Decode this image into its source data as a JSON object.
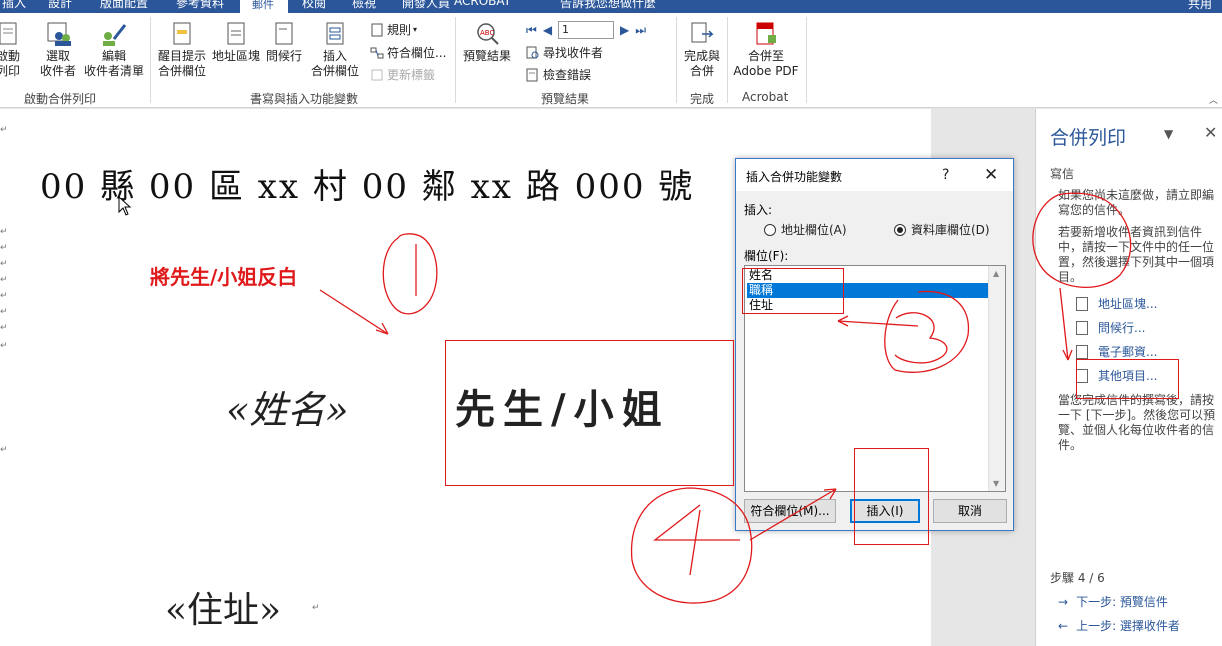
{
  "ribbon": {
    "tabs": {
      "t1": "插入",
      "t2": "設計",
      "t3": "版面配置",
      "t4": "參考資料",
      "t5": "郵件",
      "t6": "校閱",
      "t7": "檢視",
      "t8": "開發人員",
      "t9": "ACROBAT",
      "t10": "告訴我您想做什麼",
      "t11": "共用"
    },
    "start_group": {
      "start_label": "啟動\n列印",
      "select_label": "選取\n收件者",
      "edit_label": "編輯\n收件者清單",
      "group_label": "啟動合併列印"
    },
    "write_group": {
      "highlight_label": "醒目提示\n合併欄位",
      "address_label": "地址區塊",
      "greeting_label": "問候行",
      "insert_field_label": "插入\n合併欄位",
      "rules_label": "規則",
      "match_label": "符合欄位...",
      "update_label": "更新標籤",
      "group_label": "書寫與插入功能變數"
    },
    "preview_group": {
      "preview_label": "預覽結果",
      "record_value": "1",
      "find_label": "尋找收件者",
      "check_label": "檢查錯誤",
      "group_label": "預覽結果"
    },
    "finish_group": {
      "finish_label": "完成與\n合併",
      "group_label": "完成"
    },
    "acrobat_group": {
      "merge_pdf_label": "合併至\nAdobe PDF",
      "group_label": "Acrobat"
    }
  },
  "document": {
    "address_line": "00 縣 00 區 xx 村 00 鄰 xx 路 000 號",
    "annotation": "將先生/小姐反白",
    "field_name": "«姓名»",
    "title_text": "先生/小姐",
    "field_address": "«住址»",
    "para_mark": "↵"
  },
  "dialog": {
    "title": "插入合併功能變數",
    "help": "?",
    "close": "✕",
    "insert_label": "插入:",
    "radio_address": "地址欄位(A)",
    "radio_database": "資料庫欄位(D)",
    "fields_label": "欄位(F):",
    "fields": [
      "姓名",
      "職稱",
      "住址"
    ],
    "match_button": "符合欄位(M)...",
    "insert_button": "插入(I)",
    "cancel_button": "取消"
  },
  "pane": {
    "title": "合併列印",
    "section": "寫信",
    "text1": "如果您尚未這麼做，請立即編寫您的信件。",
    "text2": "若要新增收件者資訊到信件中，請按一下文件中的任一位置，然後選擇下列其中一個項目。",
    "link_address": "地址區塊...",
    "link_greeting": "問候行...",
    "link_email": "電子郵資...",
    "link_more": "其他項目...",
    "text3": "當您完成信件的撰寫後，請按一下 [下一步]。然後您可以預覽、並個人化每位收件者的信件。",
    "step": "步驟 4 / 6",
    "next": "下一步: 預覽信件",
    "prev": "上一步: 選擇收件者"
  },
  "colors": {
    "brand": "#2b579a",
    "annotation": "#e0191b",
    "selection": "#0078d7"
  }
}
